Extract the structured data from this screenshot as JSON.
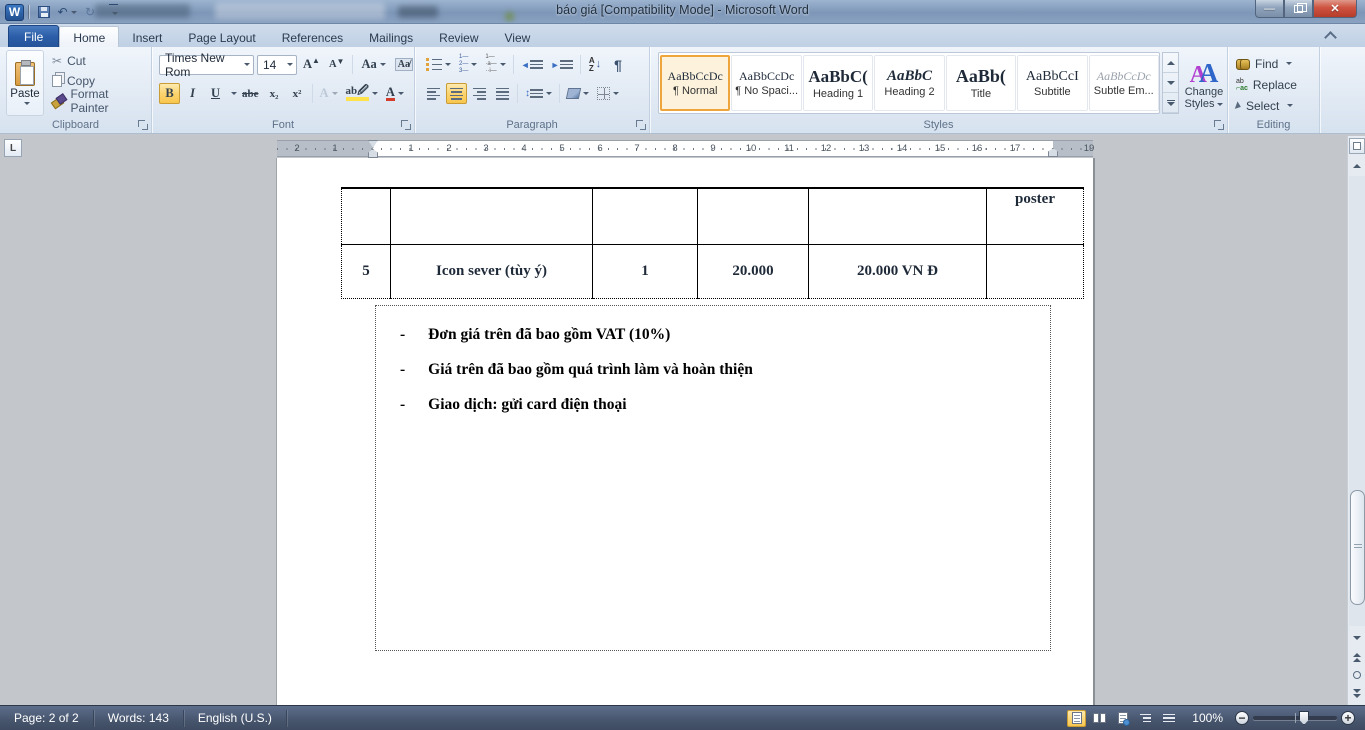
{
  "window": {
    "title": "báo giá [Compatibility Mode]  -  Microsoft Word"
  },
  "tabs": {
    "file": "File",
    "items": [
      "Home",
      "Insert",
      "Page Layout",
      "References",
      "Mailings",
      "Review",
      "View"
    ]
  },
  "ribbon": {
    "clipboard": {
      "label": "Clipboard",
      "paste": "Paste",
      "cut": "Cut",
      "copy": "Copy",
      "format_painter": "Format Painter"
    },
    "font": {
      "label": "Font",
      "family": "Times New Rom",
      "size": "14",
      "bold": "B",
      "italic": "I",
      "underline": "U",
      "strike": "abe",
      "subscript": "x₂",
      "superscript": "x²",
      "change_case": "Aa",
      "grow": "A",
      "shrink": "A",
      "effects": "A",
      "highlight": "ab",
      "color": "A"
    },
    "paragraph": {
      "label": "Paragraph",
      "pilcrow": "¶",
      "sort_a": "A",
      "sort_z": "Z"
    },
    "styles": {
      "label": "Styles",
      "items": [
        {
          "preview": "AaBbCcDc",
          "name": "¶ Normal"
        },
        {
          "preview": "AaBbCcDc",
          "name": "¶ No Spaci..."
        },
        {
          "preview": "AaBbC(",
          "name": "Heading 1"
        },
        {
          "preview": "AaBbC",
          "name": "Heading 2"
        },
        {
          "preview": "AaBb(",
          "name": "Title"
        },
        {
          "preview": "AaBbCcI",
          "name": "Subtitle"
        },
        {
          "preview": "AaBbCcDc",
          "name": "Subtle Em..."
        }
      ]
    },
    "change_styles": {
      "line1": "Change",
      "line2": "Styles"
    },
    "editing": {
      "label": "Editing",
      "find": "Find",
      "replace": "Replace",
      "select": "Select"
    }
  },
  "ruler": {
    "tab_selector": "L",
    "left": [
      "2",
      "1"
    ],
    "main": [
      "1",
      "2",
      "3",
      "4",
      "5",
      "6",
      "7",
      "8",
      "9",
      "10",
      "11",
      "12",
      "13",
      "14",
      "15",
      "16",
      "17"
    ],
    "right": "19"
  },
  "document": {
    "table": {
      "rows": [
        [
          "",
          "",
          "",
          "",
          "",
          "poster"
        ],
        [
          "5",
          "Icon sever (tùy ý)",
          "1",
          "20.000",
          "20.000 VN Đ",
          ""
        ]
      ]
    },
    "notes": {
      "bullet": "-",
      "items": [
        "Đơn giá trên đã bao gồm VAT (10%)",
        "Giá trên đã bao gồm quá trình làm và hoàn thiện",
        "Giao dịch: gửi card điện thoại"
      ]
    }
  },
  "status": {
    "page": "Page: 2 of 2",
    "words": "Words: 143",
    "language": "English (U.S.)",
    "zoom_level": "100%"
  },
  "colors": {
    "accent_selection": "#fbd46f",
    "file_tab_blue": "#2b5da8",
    "close_button_red": "#ce5340",
    "status_bar": "#47556d",
    "workspace_gray": "#c3c6ca",
    "page_white": "#ffffff"
  }
}
